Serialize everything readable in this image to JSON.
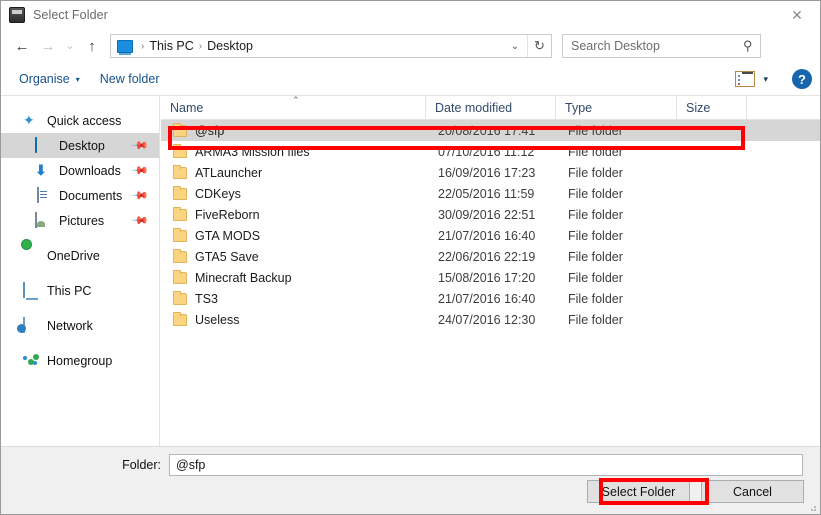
{
  "window": {
    "title": "Select Folder",
    "app_icon": "arma-app-icon",
    "close_label": "✕"
  },
  "nav": {
    "back": "←",
    "forward": "→",
    "recent": "⌄",
    "up": "↑",
    "address": {
      "icon": "this-pc-monitor-icon",
      "crumbs": [
        "This PC",
        "Desktop"
      ],
      "separator": "›",
      "dropdown": "⌄",
      "refresh": "↻"
    },
    "search": {
      "placeholder": "Search Desktop",
      "icon": "search-icon"
    }
  },
  "commandbar": {
    "organise": "Organise",
    "organise_caret": "▾",
    "new_folder": "New folder",
    "view_caret": "▾",
    "help": "?"
  },
  "sidebar": {
    "items": [
      {
        "label": "Quick access",
        "icon": "quick-access-star-icon",
        "pinned": false,
        "selected": false,
        "indent": false
      },
      {
        "label": "Desktop",
        "icon": "desktop-monitor-icon",
        "pinned": true,
        "selected": true,
        "indent": true
      },
      {
        "label": "Downloads",
        "icon": "downloads-arrow-icon",
        "pinned": true,
        "selected": false,
        "indent": true
      },
      {
        "label": "Documents",
        "icon": "documents-icon",
        "pinned": true,
        "selected": false,
        "indent": true
      },
      {
        "label": "Pictures",
        "icon": "pictures-icon",
        "pinned": true,
        "selected": false,
        "indent": true
      },
      {
        "label": "OneDrive",
        "icon": "onedrive-cloud-icon",
        "pinned": false,
        "selected": false,
        "indent": false
      },
      {
        "label": "This PC",
        "icon": "this-pc-icon",
        "pinned": false,
        "selected": false,
        "indent": false
      },
      {
        "label": "Network",
        "icon": "network-icon",
        "pinned": false,
        "selected": false,
        "indent": false
      },
      {
        "label": "Homegroup",
        "icon": "homegroup-icon",
        "pinned": false,
        "selected": false,
        "indent": false
      }
    ],
    "pin_glyph": "📌"
  },
  "filelist": {
    "columns": [
      "Name",
      "Date modified",
      "Type",
      "Size"
    ],
    "sort_column": "Name",
    "sort_arrow": "⌃",
    "rows": [
      {
        "name": "@sfp",
        "date": "20/08/2016 17:41",
        "type": "File folder",
        "size": "",
        "selected": true
      },
      {
        "name": "ARMA3 Mission files",
        "date": "07/10/2016 11:12",
        "type": "File folder",
        "size": "",
        "selected": false
      },
      {
        "name": "ATLauncher",
        "date": "16/09/2016 17:23",
        "type": "File folder",
        "size": "",
        "selected": false
      },
      {
        "name": "CDKeys",
        "date": "22/05/2016 11:59",
        "type": "File folder",
        "size": "",
        "selected": false
      },
      {
        "name": "FiveReborn",
        "date": "30/09/2016 22:51",
        "type": "File folder",
        "size": "",
        "selected": false
      },
      {
        "name": "GTA MODS",
        "date": "21/07/2016 16:40",
        "type": "File folder",
        "size": "",
        "selected": false
      },
      {
        "name": "GTA5 Save",
        "date": "22/06/2016 22:19",
        "type": "File folder",
        "size": "",
        "selected": false
      },
      {
        "name": "Minecraft Backup",
        "date": "15/08/2016 17:20",
        "type": "File folder",
        "size": "",
        "selected": false
      },
      {
        "name": "TS3",
        "date": "21/07/2016 16:40",
        "type": "File folder",
        "size": "",
        "selected": false
      },
      {
        "name": "Useless",
        "date": "24/07/2016 12:30",
        "type": "File folder",
        "size": "",
        "selected": false
      }
    ]
  },
  "footer": {
    "folder_label": "Folder:",
    "folder_value": "@sfp",
    "select_button": "Select Folder",
    "cancel_button": "Cancel"
  },
  "annotations": {
    "color": "#ff0000",
    "boxes": [
      "selected-folder-row",
      "select-folder-button"
    ]
  }
}
